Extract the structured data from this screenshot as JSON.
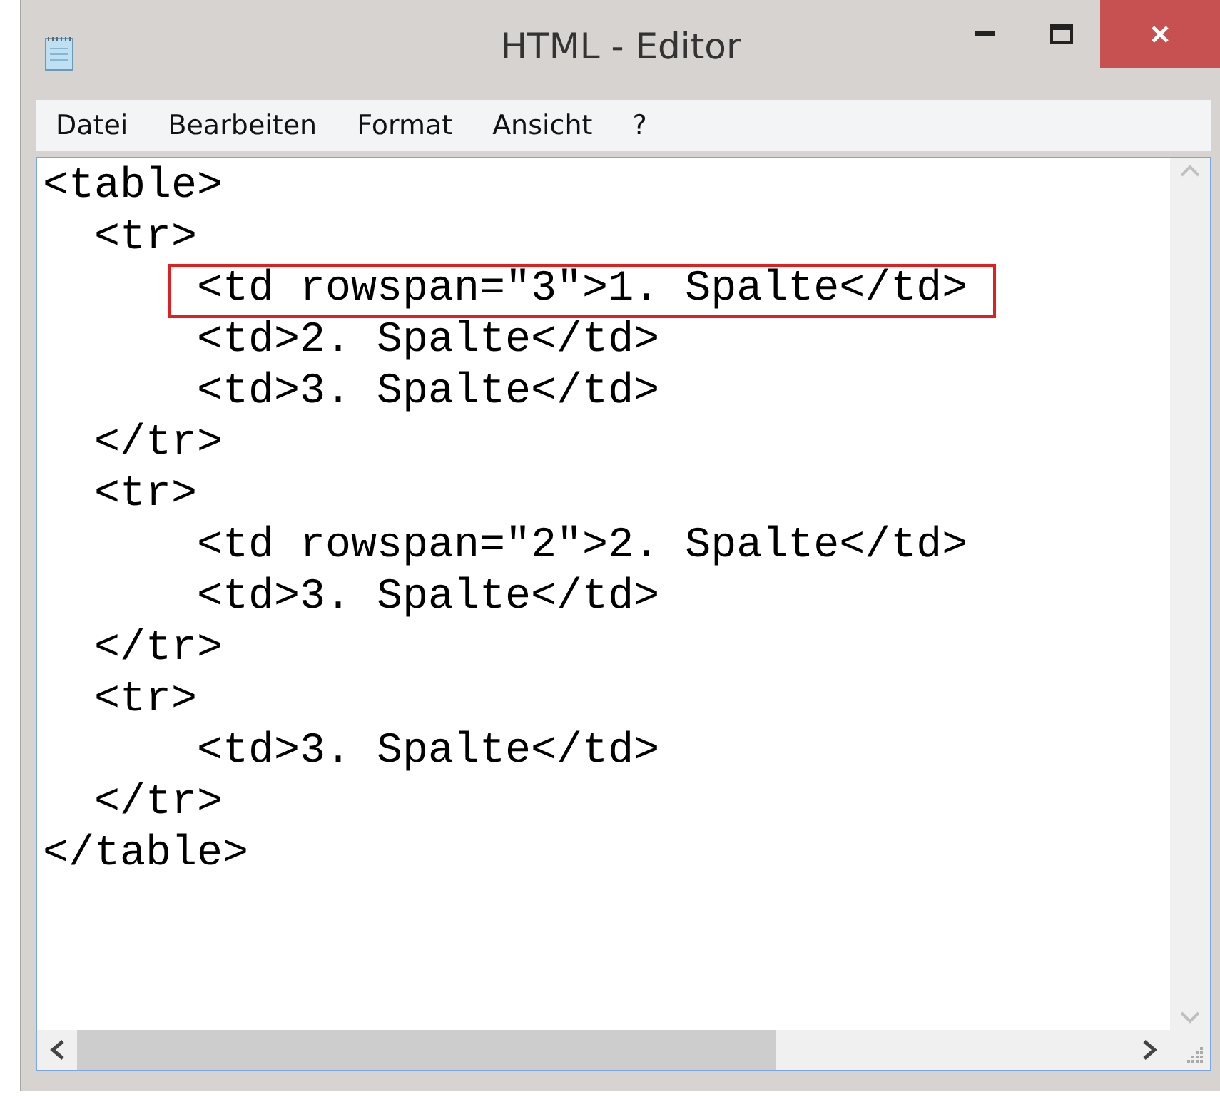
{
  "window": {
    "title": "HTML - Editor"
  },
  "menu": [
    {
      "label": "Datei"
    },
    {
      "label": "Bearbeiten"
    },
    {
      "label": "Format"
    },
    {
      "label": "Ansicht"
    },
    {
      "label": "?"
    }
  ],
  "editor": {
    "lines": [
      {
        "text": "<table>",
        "highlighted": false
      },
      {
        "text": "  <tr>",
        "highlighted": false
      },
      {
        "text": "      <td rowspan=\"3\">1. Spalte</td>",
        "highlighted": true
      },
      {
        "text": "      <td>2. Spalte</td>",
        "highlighted": false
      },
      {
        "text": "      <td>3. Spalte</td>",
        "highlighted": false
      },
      {
        "text": "  </tr>",
        "highlighted": false
      },
      {
        "text": "  <tr>",
        "highlighted": false
      },
      {
        "text": "      <td rowspan=\"2\">2. Spalte</td>",
        "highlighted": false
      },
      {
        "text": "      <td>3. Spalte</td>",
        "highlighted": false
      },
      {
        "text": "  </tr>",
        "highlighted": false
      },
      {
        "text": "  <tr>",
        "highlighted": false
      },
      {
        "text": "      <td>3. Spalte</td>",
        "highlighted": false
      },
      {
        "text": "  </tr>",
        "highlighted": false
      },
      {
        "text": "</table>",
        "highlighted": false
      }
    ]
  }
}
